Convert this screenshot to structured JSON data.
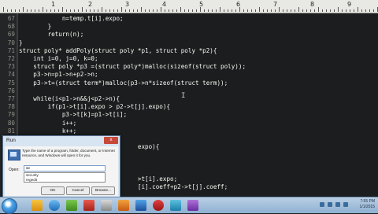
{
  "ruler": {
    "numbers": [
      "1",
      "2",
      "3",
      "4",
      "5",
      "6",
      "7",
      "8",
      "9"
    ]
  },
  "editor": {
    "lines": [
      {
        "num": "67",
        "code": "            n=temp.t[i].expo;"
      },
      {
        "num": "68",
        "code": "        }"
      },
      {
        "num": "69",
        "code": "        return(n);"
      },
      {
        "num": "70",
        "code": "}"
      },
      {
        "num": "71",
        "code": "struct poly* addPoly(struct poly *p1, struct poly *p2){"
      },
      {
        "num": "72",
        "code": "    int i=0, j=0, k=0;"
      },
      {
        "num": "73",
        "code": "    struct poly *p3 =(struct poly*)malloc(sizeof(struct poly));"
      },
      {
        "num": "74",
        "code": "    p3->n=p1->n+p2->n;"
      },
      {
        "num": "75",
        "code": "    p3->t=(struct term*)malloc(p3->n*sizeof(struct term));"
      },
      {
        "num": "76",
        "code": ""
      },
      {
        "num": "77",
        "code": "    while(i<p1->n&&j<p2->n){"
      },
      {
        "num": "78",
        "code": "        if(p1->t[i].expo > p2->t[j].expo){"
      },
      {
        "num": "79",
        "code": "            p3->t[k]=p1->t[i];"
      },
      {
        "num": "80",
        "code": "            i++;"
      },
      {
        "num": "81",
        "code": "            k++;"
      },
      {
        "num": "82",
        "code": "        }"
      },
      {
        "num": "83",
        "code": "                                 expo){"
      },
      {
        "num": "84",
        "code": ""
      },
      {
        "num": "85",
        "code": ""
      },
      {
        "num": "86",
        "code": ""
      },
      {
        "num": "87",
        "code": "                                 >t[i].expo;"
      },
      {
        "num": "88",
        "code": "                                 [i].coeff+p2->t[j].coeff;"
      }
    ]
  },
  "run_dialog": {
    "title": "Run",
    "close_label": "x",
    "description": "Type the name of a program, folder, document, or Internet resource, and Windows will open it for you.",
    "open_label": "Open:",
    "input_value": "se",
    "dropdown_options": [
      "security",
      "regedit"
    ],
    "ok_label": "OK",
    "cancel_label": "Cancel",
    "browse_label": "Browse..."
  },
  "taskbar": {
    "clock_time": "7:55 PM",
    "clock_date": "1/1/2015"
  },
  "colors": {
    "background": "#1b1d1e",
    "code_text": "#f8f8f2",
    "line_number": "#8f908a"
  }
}
